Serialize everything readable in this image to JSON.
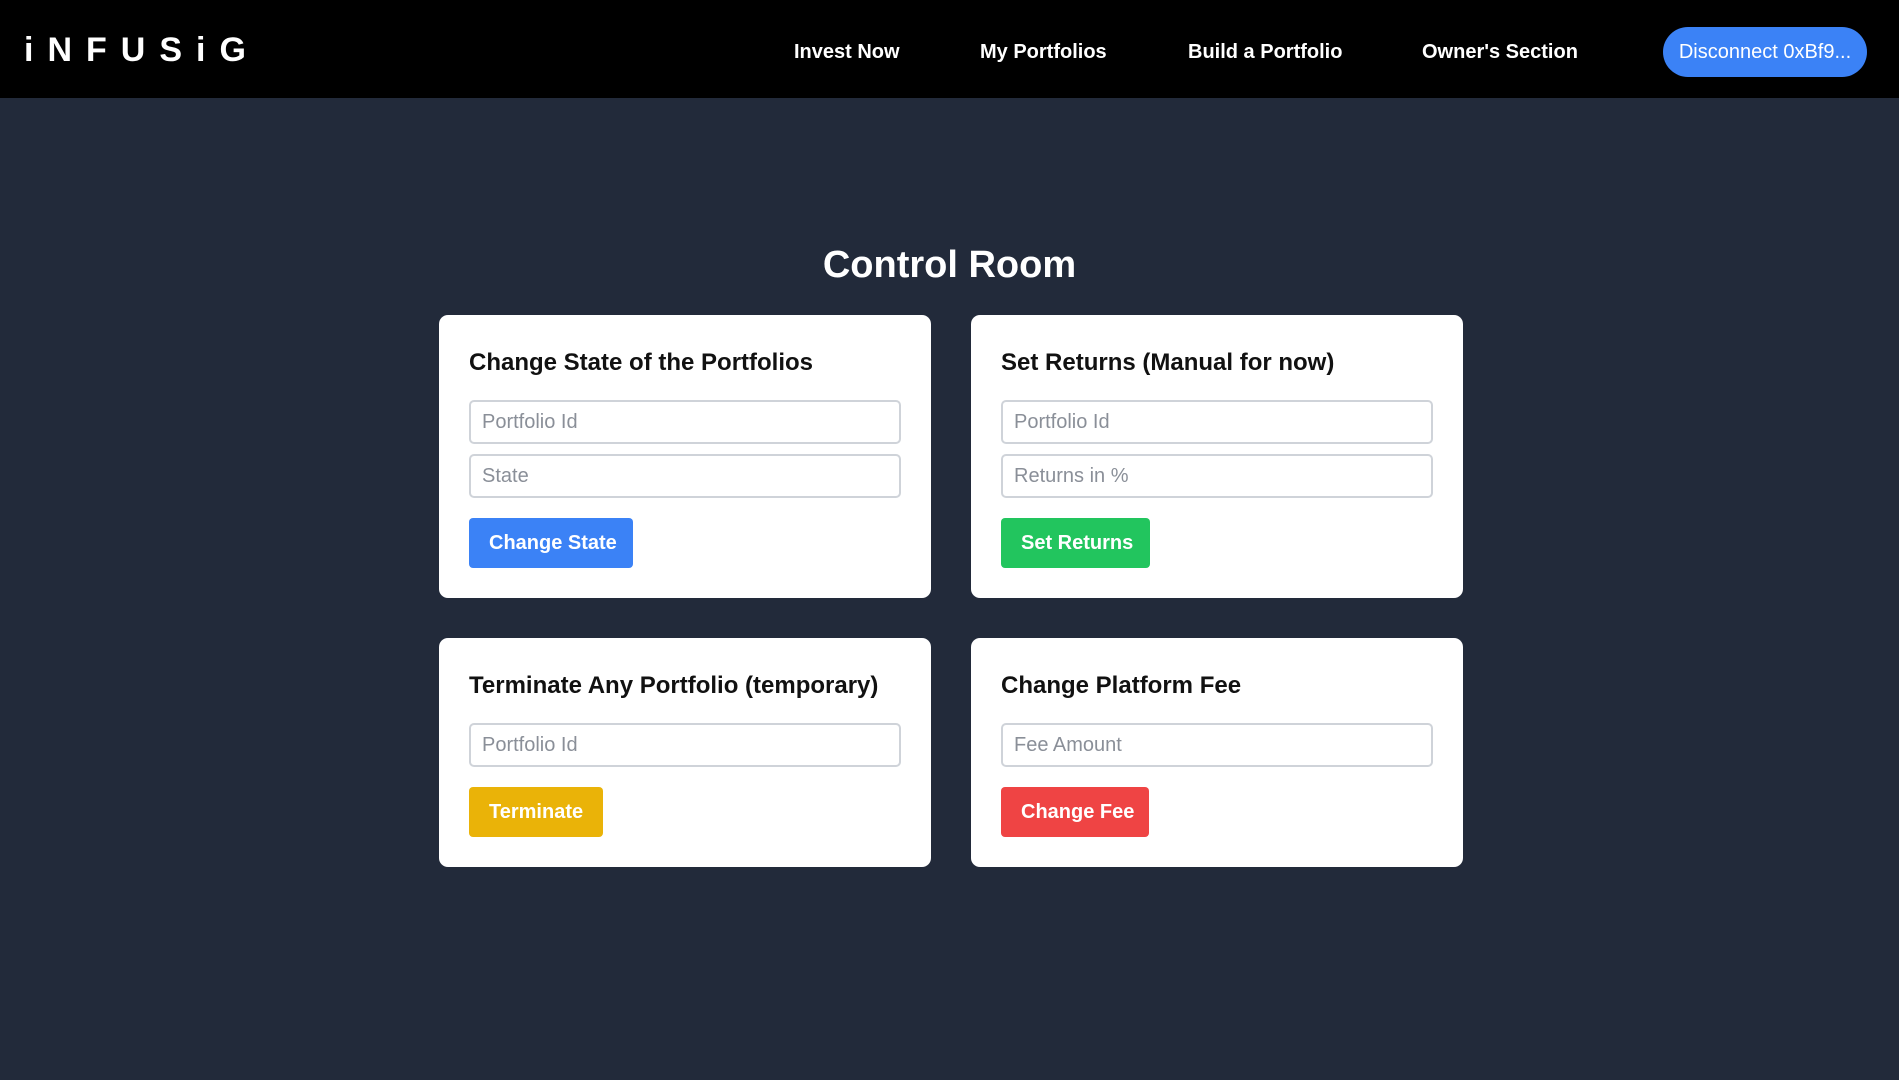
{
  "brand": {
    "logo_text": "iNFUSiG"
  },
  "nav": {
    "links": [
      "Invest Now",
      "My Portfolios",
      "Build a Portfolio",
      "Owner's Section"
    ],
    "wallet_button": "Disconnect 0xBf9..."
  },
  "main": {
    "title": "Control Room",
    "cards": [
      {
        "title": "Change State of the Portfolios",
        "fields": [
          {
            "placeholder": "Portfolio Id",
            "value": ""
          },
          {
            "placeholder": "State",
            "value": ""
          }
        ],
        "button": "Change State",
        "button_color": "#3b82f6"
      },
      {
        "title": "Set Returns (Manual for now)",
        "fields": [
          {
            "placeholder": "Portfolio Id",
            "value": ""
          },
          {
            "placeholder": "Returns in %",
            "value": ""
          }
        ],
        "button": "Set Returns",
        "button_color": "#22c55e"
      },
      {
        "title": "Terminate Any Portfolio (temporary)",
        "fields": [
          {
            "placeholder": "Portfolio Id",
            "value": ""
          }
        ],
        "button": "Terminate",
        "button_color": "#eab308"
      },
      {
        "title": "Change Platform Fee",
        "fields": [
          {
            "placeholder": "Fee Amount",
            "value": ""
          }
        ],
        "button": "Change Fee",
        "button_color": "#ef4444"
      }
    ]
  },
  "colors": {
    "navbar_bg": "#000000",
    "page_bg": "#222a3a",
    "card_bg": "#ffffff",
    "accent_blue": "#3b82f6"
  }
}
